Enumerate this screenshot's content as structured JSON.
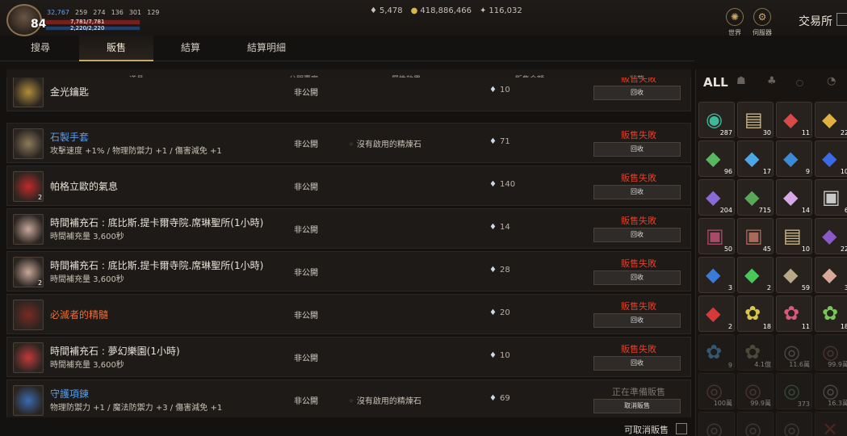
{
  "player": {
    "level": "84",
    "stat_power": "32,767",
    "stat_a": "259",
    "stat_b": "274",
    "stat_c": "136",
    "stat_d": "301",
    "stat_e": "129",
    "hp_text": "7,781/7,781",
    "mp_text": "2,220/2,220"
  },
  "currency": {
    "gems": "5,478",
    "gold": "418,886,466",
    "other": "116,032"
  },
  "top_buttons": [
    {
      "label": "世界",
      "icon": "globe-icon"
    },
    {
      "label": "伺服器",
      "icon": "server-icon"
    }
  ],
  "exchange": {
    "title": "交易所"
  },
  "tabs": [
    "搜尋",
    "販售",
    "結算",
    "結算明細"
  ],
  "active_tab": "販售",
  "table_headers": {
    "item": "道具",
    "seller": "公開賣家",
    "effect": "屬性效果",
    "price": "販售金額",
    "status": "狀態"
  },
  "rows": [
    {
      "name": "金光鑰匙",
      "sub": "",
      "name_color": "white",
      "qty": "",
      "seller": "非公開",
      "effect": "",
      "price": "10",
      "status": "販售失敗",
      "status_type": "fail",
      "action": "回收",
      "icon_color": "#b08d3a"
    },
    {
      "name": "石製手套",
      "sub": "攻擊速度 +1% / 物理防禦力 +1 / 傷害減免 +1",
      "name_color": "blue",
      "qty": "",
      "seller": "非公開",
      "effect": "沒有啟用的精煉石",
      "price": "71",
      "status": "販售失敗",
      "status_type": "fail",
      "action": "回收",
      "icon_color": "#8c7a5a"
    },
    {
      "name": "帕格立歐的氣息",
      "sub": "",
      "name_color": "white",
      "qty": "2",
      "seller": "非公開",
      "effect": "",
      "price": "140",
      "status": "販售失敗",
      "status_type": "fail",
      "action": "回收",
      "icon_color": "#c02a2a"
    },
    {
      "name": "時間補充石 : 底比斯.提卡爾寺院.席琳聖所(1小時)",
      "sub": "時間補充量 3,600秒",
      "name_color": "white",
      "qty": "",
      "seller": "非公開",
      "effect": "",
      "price": "14",
      "status": "販售失敗",
      "status_type": "fail",
      "action": "回收",
      "icon_color": "#c8a89a"
    },
    {
      "name": "時間補充石 : 底比斯.提卡爾寺院.席琳聖所(1小時)",
      "sub": "時間補充量 3,600秒",
      "name_color": "white",
      "qty": "2",
      "seller": "非公開",
      "effect": "",
      "price": "28",
      "status": "販售失敗",
      "status_type": "fail",
      "action": "回收",
      "icon_color": "#c8a89a"
    },
    {
      "name": "必滅者的精髓",
      "sub": "",
      "name_color": "orange",
      "qty": "",
      "seller": "非公開",
      "effect": "",
      "price": "20",
      "status": "販售失敗",
      "status_type": "fail",
      "action": "回收",
      "icon_color": "#7a2a22"
    },
    {
      "name": "時間補充石 : 夢幻樂園(1小時)",
      "sub": "時間補充量 3,600秒",
      "name_color": "white",
      "qty": "",
      "seller": "非公開",
      "effect": "",
      "price": "10",
      "status": "販售失敗",
      "status_type": "fail",
      "action": "回收",
      "icon_color": "#c03a3a"
    },
    {
      "name": "守護項鍊",
      "sub": "物理防禦力 +1 / 魔法防禦力 +3 / 傷害減免 +1",
      "name_color": "blue",
      "qty": "",
      "seller": "非公開",
      "effect": "沒有啟用的精煉石",
      "price": "69",
      "status": "正在準備販售",
      "status_type": "prep",
      "action": "取消販售",
      "icon_color": "#3a6ab0"
    }
  ],
  "bottom": {
    "cancel_label": "可取消販售"
  },
  "inventory": {
    "tabs": [
      "ALL"
    ],
    "slots": [
      {
        "count": "287",
        "color": "#3fb89a",
        "glyph": "◉"
      },
      {
        "count": "30",
        "color": "#c8b48a",
        "glyph": "▤"
      },
      {
        "count": "11",
        "color": "#d84a4a",
        "glyph": "◆"
      },
      {
        "count": "22",
        "color": "#e0b040",
        "glyph": "◆"
      },
      {
        "count": "96",
        "color": "#58b860",
        "glyph": "◆"
      },
      {
        "count": "17",
        "color": "#4aa8e8",
        "glyph": "◆"
      },
      {
        "count": "9",
        "color": "#3a8ad8",
        "glyph": "◆"
      },
      {
        "count": "10",
        "color": "#3a6ae8",
        "glyph": "◆"
      },
      {
        "count": "204",
        "color": "#8a6ad8",
        "glyph": "◆"
      },
      {
        "count": "715",
        "color": "#58a858",
        "glyph": "◆"
      },
      {
        "count": "14",
        "color": "#d8a8e8",
        "glyph": "◆"
      },
      {
        "count": "6",
        "color": "#c8c8c8",
        "glyph": "▣"
      },
      {
        "count": "50",
        "color": "#a84a6a",
        "glyph": "▣"
      },
      {
        "count": "45",
        "color": "#a86a5a",
        "glyph": "▣"
      },
      {
        "count": "10",
        "color": "#c8b48a",
        "glyph": "▤"
      },
      {
        "count": "22",
        "color": "#8a58c8",
        "glyph": "◆"
      },
      {
        "count": "3",
        "color": "#3a7ad8",
        "glyph": "◆"
      },
      {
        "count": "2",
        "color": "#48c858",
        "glyph": "◆"
      },
      {
        "count": "59",
        "color": "#b8a888",
        "glyph": "◆"
      },
      {
        "count": "3",
        "color": "#d8a898",
        "glyph": "◆"
      },
      {
        "count": "2",
        "color": "#d83a3a",
        "glyph": "◆"
      },
      {
        "count": "18",
        "color": "#d8c848",
        "glyph": "✿"
      },
      {
        "count": "11",
        "color": "#d85a7a",
        "glyph": "✿"
      },
      {
        "count": "18",
        "color": "#78c858",
        "glyph": "✿"
      },
      {
        "count": "9",
        "color": "#58a8e8",
        "glyph": "✿"
      },
      {
        "count": "4.1億",
        "color": "#8a8a6a",
        "glyph": "✿"
      },
      {
        "count": "11.6萬",
        "color": "#8a8a8a",
        "glyph": "◎"
      },
      {
        "count": "99.9萬",
        "color": "#8a5a5a",
        "glyph": "◎"
      },
      {
        "count": "100萬",
        "color": "#8a5a5a",
        "glyph": "◎"
      },
      {
        "count": "99.9萬",
        "color": "#8a5a5a",
        "glyph": "◎"
      },
      {
        "count": "373",
        "color": "#5a8a5a",
        "glyph": "◎"
      },
      {
        "count": "16.3萬",
        "color": "#8a8a8a",
        "glyph": "◎"
      },
      {
        "count": "",
        "color": "#6a6a6a",
        "glyph": "◎"
      },
      {
        "count": "",
        "color": "#6a6a6a",
        "glyph": "◎"
      },
      {
        "count": "",
        "color": "#6a6a6a",
        "glyph": "◎"
      },
      {
        "count": "",
        "color": "#8a3a3a",
        "glyph": "✕"
      }
    ]
  }
}
